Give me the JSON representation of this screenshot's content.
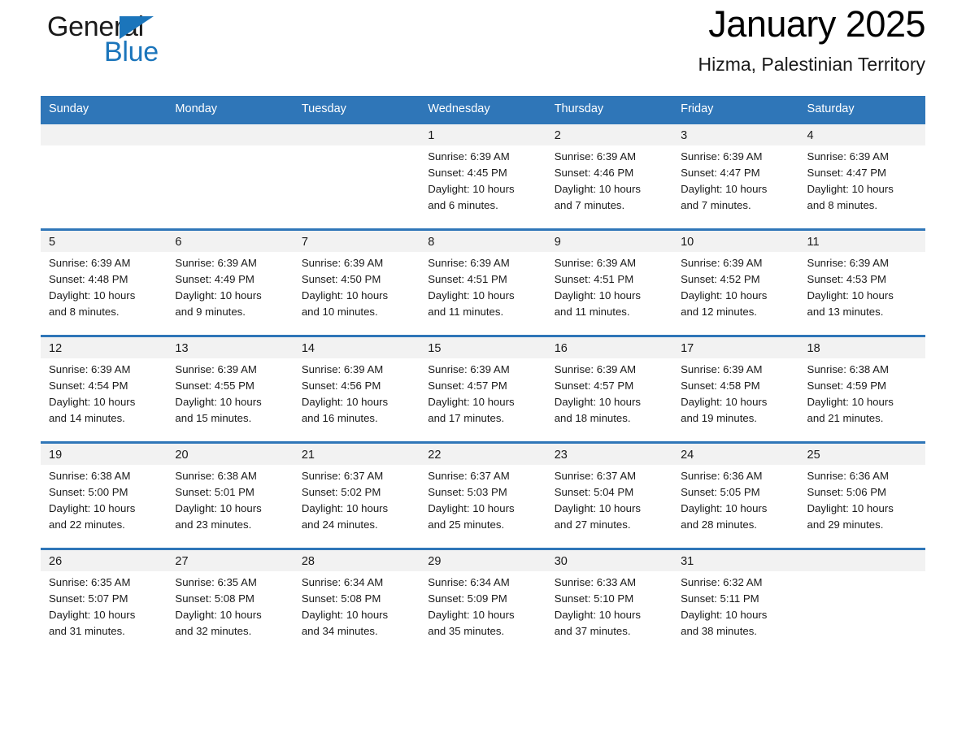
{
  "brand": {
    "name_part1": "General",
    "name_part2": "Blue",
    "logo_icon": "triangle-logo-icon",
    "color_blue": "#1b75bb"
  },
  "header": {
    "month_title": "January 2025",
    "location": "Hizma, Palestinian Territory"
  },
  "theme": {
    "header_blue": "#2f76b8",
    "daynum_band": "#f2f2f2",
    "text": "#1a1a1a"
  },
  "weekdays": [
    "Sunday",
    "Monday",
    "Tuesday",
    "Wednesday",
    "Thursday",
    "Friday",
    "Saturday"
  ],
  "weeks": [
    {
      "days": [
        {
          "num": "",
          "lines": []
        },
        {
          "num": "",
          "lines": []
        },
        {
          "num": "",
          "lines": []
        },
        {
          "num": "1",
          "lines": [
            "Sunrise: 6:39 AM",
            "Sunset: 4:45 PM",
            "Daylight: 10 hours",
            "and 6 minutes."
          ]
        },
        {
          "num": "2",
          "lines": [
            "Sunrise: 6:39 AM",
            "Sunset: 4:46 PM",
            "Daylight: 10 hours",
            "and 7 minutes."
          ]
        },
        {
          "num": "3",
          "lines": [
            "Sunrise: 6:39 AM",
            "Sunset: 4:47 PM",
            "Daylight: 10 hours",
            "and 7 minutes."
          ]
        },
        {
          "num": "4",
          "lines": [
            "Sunrise: 6:39 AM",
            "Sunset: 4:47 PM",
            "Daylight: 10 hours",
            "and 8 minutes."
          ]
        }
      ]
    },
    {
      "days": [
        {
          "num": "5",
          "lines": [
            "Sunrise: 6:39 AM",
            "Sunset: 4:48 PM",
            "Daylight: 10 hours",
            "and 8 minutes."
          ]
        },
        {
          "num": "6",
          "lines": [
            "Sunrise: 6:39 AM",
            "Sunset: 4:49 PM",
            "Daylight: 10 hours",
            "and 9 minutes."
          ]
        },
        {
          "num": "7",
          "lines": [
            "Sunrise: 6:39 AM",
            "Sunset: 4:50 PM",
            "Daylight: 10 hours",
            "and 10 minutes."
          ]
        },
        {
          "num": "8",
          "lines": [
            "Sunrise: 6:39 AM",
            "Sunset: 4:51 PM",
            "Daylight: 10 hours",
            "and 11 minutes."
          ]
        },
        {
          "num": "9",
          "lines": [
            "Sunrise: 6:39 AM",
            "Sunset: 4:51 PM",
            "Daylight: 10 hours",
            "and 11 minutes."
          ]
        },
        {
          "num": "10",
          "lines": [
            "Sunrise: 6:39 AM",
            "Sunset: 4:52 PM",
            "Daylight: 10 hours",
            "and 12 minutes."
          ]
        },
        {
          "num": "11",
          "lines": [
            "Sunrise: 6:39 AM",
            "Sunset: 4:53 PM",
            "Daylight: 10 hours",
            "and 13 minutes."
          ]
        }
      ]
    },
    {
      "days": [
        {
          "num": "12",
          "lines": [
            "Sunrise: 6:39 AM",
            "Sunset: 4:54 PM",
            "Daylight: 10 hours",
            "and 14 minutes."
          ]
        },
        {
          "num": "13",
          "lines": [
            "Sunrise: 6:39 AM",
            "Sunset: 4:55 PM",
            "Daylight: 10 hours",
            "and 15 minutes."
          ]
        },
        {
          "num": "14",
          "lines": [
            "Sunrise: 6:39 AM",
            "Sunset: 4:56 PM",
            "Daylight: 10 hours",
            "and 16 minutes."
          ]
        },
        {
          "num": "15",
          "lines": [
            "Sunrise: 6:39 AM",
            "Sunset: 4:57 PM",
            "Daylight: 10 hours",
            "and 17 minutes."
          ]
        },
        {
          "num": "16",
          "lines": [
            "Sunrise: 6:39 AM",
            "Sunset: 4:57 PM",
            "Daylight: 10 hours",
            "and 18 minutes."
          ]
        },
        {
          "num": "17",
          "lines": [
            "Sunrise: 6:39 AM",
            "Sunset: 4:58 PM",
            "Daylight: 10 hours",
            "and 19 minutes."
          ]
        },
        {
          "num": "18",
          "lines": [
            "Sunrise: 6:38 AM",
            "Sunset: 4:59 PM",
            "Daylight: 10 hours",
            "and 21 minutes."
          ]
        }
      ]
    },
    {
      "days": [
        {
          "num": "19",
          "lines": [
            "Sunrise: 6:38 AM",
            "Sunset: 5:00 PM",
            "Daylight: 10 hours",
            "and 22 minutes."
          ]
        },
        {
          "num": "20",
          "lines": [
            "Sunrise: 6:38 AM",
            "Sunset: 5:01 PM",
            "Daylight: 10 hours",
            "and 23 minutes."
          ]
        },
        {
          "num": "21",
          "lines": [
            "Sunrise: 6:37 AM",
            "Sunset: 5:02 PM",
            "Daylight: 10 hours",
            "and 24 minutes."
          ]
        },
        {
          "num": "22",
          "lines": [
            "Sunrise: 6:37 AM",
            "Sunset: 5:03 PM",
            "Daylight: 10 hours",
            "and 25 minutes."
          ]
        },
        {
          "num": "23",
          "lines": [
            "Sunrise: 6:37 AM",
            "Sunset: 5:04 PM",
            "Daylight: 10 hours",
            "and 27 minutes."
          ]
        },
        {
          "num": "24",
          "lines": [
            "Sunrise: 6:36 AM",
            "Sunset: 5:05 PM",
            "Daylight: 10 hours",
            "and 28 minutes."
          ]
        },
        {
          "num": "25",
          "lines": [
            "Sunrise: 6:36 AM",
            "Sunset: 5:06 PM",
            "Daylight: 10 hours",
            "and 29 minutes."
          ]
        }
      ]
    },
    {
      "days": [
        {
          "num": "26",
          "lines": [
            "Sunrise: 6:35 AM",
            "Sunset: 5:07 PM",
            "Daylight: 10 hours",
            "and 31 minutes."
          ]
        },
        {
          "num": "27",
          "lines": [
            "Sunrise: 6:35 AM",
            "Sunset: 5:08 PM",
            "Daylight: 10 hours",
            "and 32 minutes."
          ]
        },
        {
          "num": "28",
          "lines": [
            "Sunrise: 6:34 AM",
            "Sunset: 5:08 PM",
            "Daylight: 10 hours",
            "and 34 minutes."
          ]
        },
        {
          "num": "29",
          "lines": [
            "Sunrise: 6:34 AM",
            "Sunset: 5:09 PM",
            "Daylight: 10 hours",
            "and 35 minutes."
          ]
        },
        {
          "num": "30",
          "lines": [
            "Sunrise: 6:33 AM",
            "Sunset: 5:10 PM",
            "Daylight: 10 hours",
            "and 37 minutes."
          ]
        },
        {
          "num": "31",
          "lines": [
            "Sunrise: 6:32 AM",
            "Sunset: 5:11 PM",
            "Daylight: 10 hours",
            "and 38 minutes."
          ]
        },
        {
          "num": "",
          "lines": []
        }
      ]
    }
  ]
}
